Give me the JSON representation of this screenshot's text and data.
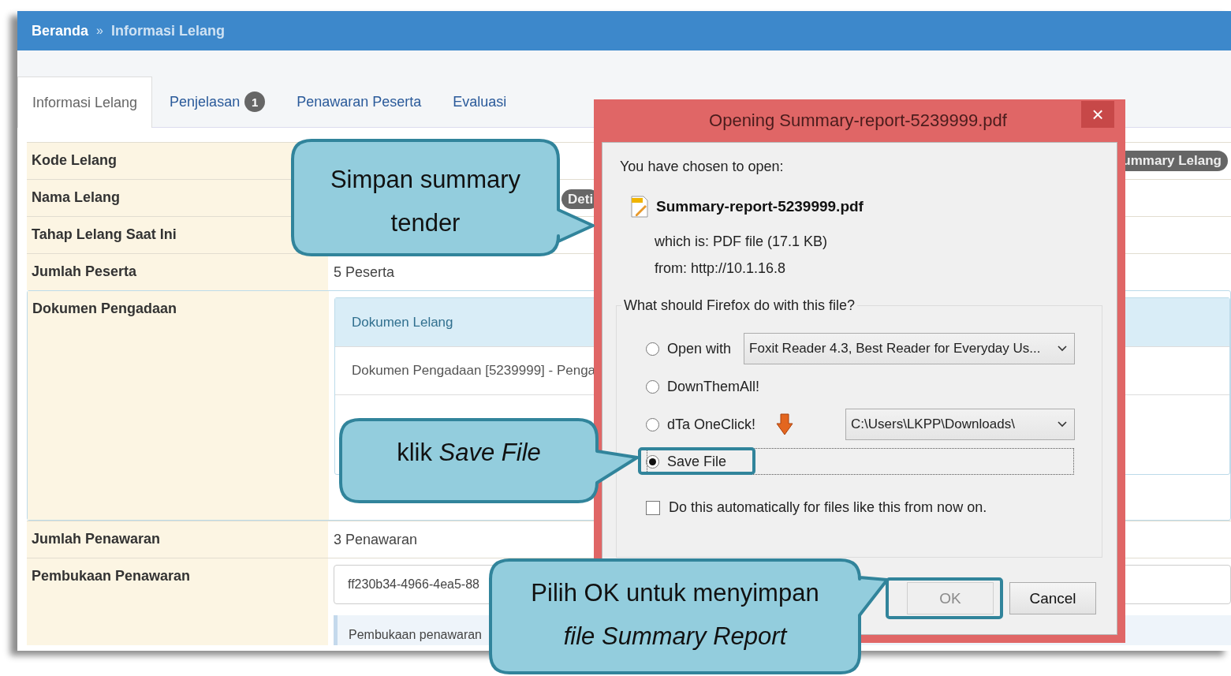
{
  "breadcrumb": {
    "separator": "»",
    "items": [
      {
        "label": "Beranda",
        "current": false
      },
      {
        "label": "Informasi Lelang",
        "current": true
      }
    ]
  },
  "tabs": [
    {
      "label": "Informasi Lelang",
      "selected": true
    },
    {
      "label": "Penjelasan",
      "selected": false,
      "badge": "1"
    },
    {
      "label": "Penawaran Peserta",
      "selected": false
    },
    {
      "label": "Evaluasi",
      "selected": false
    }
  ],
  "rows": [
    {
      "label": "Kode Lelang",
      "kind": "end-button",
      "button": "ummary Lelang"
    },
    {
      "label": "Nama Lelang",
      "kind": "inline-button",
      "button": "Deti"
    },
    {
      "label": "Tahap Lelang Saat Ini",
      "kind": "empty"
    },
    {
      "label": "Jumlah Peserta",
      "kind": "text",
      "value": "5 Peserta"
    },
    {
      "label": "Dokumen Pengadaan",
      "kind": "panel",
      "heading": "Dokumen Lelang",
      "items": [
        "Dokumen Pengadaan [5239999] - Penga"
      ]
    },
    {
      "label": "Jumlah Penawaran",
      "kind": "text",
      "value": "3 Penawaran"
    },
    {
      "label": "Pembukaan Penawaran",
      "kind": "field-panel",
      "field": "ff230b34-4966-4ea5-88",
      "panel_text": "Pembukaan penawaran"
    }
  ],
  "dialog": {
    "title": "Opening Summary-report-5239999.pdf",
    "close": "×",
    "intro": "You have chosen to open:",
    "filename": "Summary-report-5239999.pdf",
    "which_is": "which is: PDF file (17.1 KB)",
    "from": "from: http://10.1.16.8",
    "question": "What should Firefox do with this file?",
    "options": [
      {
        "kind": "select",
        "label": "Open with",
        "selected": false,
        "select_value": "Foxit Reader 4.3, Best Reader for Everyday Us..."
      },
      {
        "kind": "plain",
        "label": "DownThemAll!",
        "selected": false
      },
      {
        "kind": "icon-select",
        "label": "dTa OneClick!",
        "selected": false,
        "select_value": "C:\\Users\\LKPP\\Downloads\\"
      },
      {
        "kind": "plain",
        "label": "Save File",
        "selected": true
      }
    ],
    "auto": {
      "label": "Do this automatically for files like this from now on.",
      "checked": false
    },
    "buttons": [
      {
        "label": "OK",
        "disabled": true
      },
      {
        "label": "Cancel",
        "disabled": false
      }
    ]
  },
  "callouts": [
    {
      "text": "Simpan summary tender"
    },
    {
      "text": "klik *Save File*"
    },
    {
      "text": "Pilih OK untuk menyimpan *file Summary Report*"
    }
  ]
}
